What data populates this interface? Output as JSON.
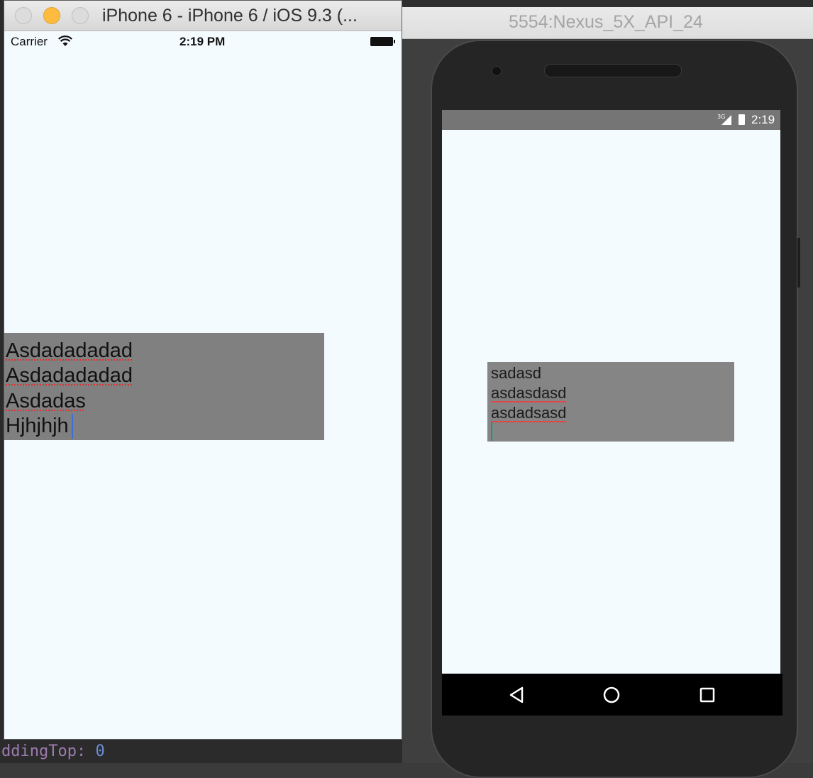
{
  "editor": {
    "bottom_code_prop": "ddingTop: ",
    "bottom_code_value": "0"
  },
  "ios_simulator": {
    "window_title": "iPhone 6 - iPhone 6 / iOS 9.3 (...",
    "status": {
      "carrier": "Carrier",
      "time": "2:19 PM"
    },
    "text_input_lines": [
      "Asdadadadad",
      "Asdadadadad",
      "Asdadas",
      "Hjhjhjh"
    ],
    "text_input_bg": "#808080"
  },
  "android_emulator": {
    "window_title": "5554:Nexus_5X_API_24",
    "status": {
      "network": "3G",
      "time": "2:19"
    },
    "text_input_lines": [
      "sadasd",
      "asdasdasd",
      "asdadsasd",
      ""
    ],
    "text_input_bg": "#858585",
    "nav_icons": [
      "back-icon",
      "home-icon",
      "recents-icon"
    ]
  }
}
